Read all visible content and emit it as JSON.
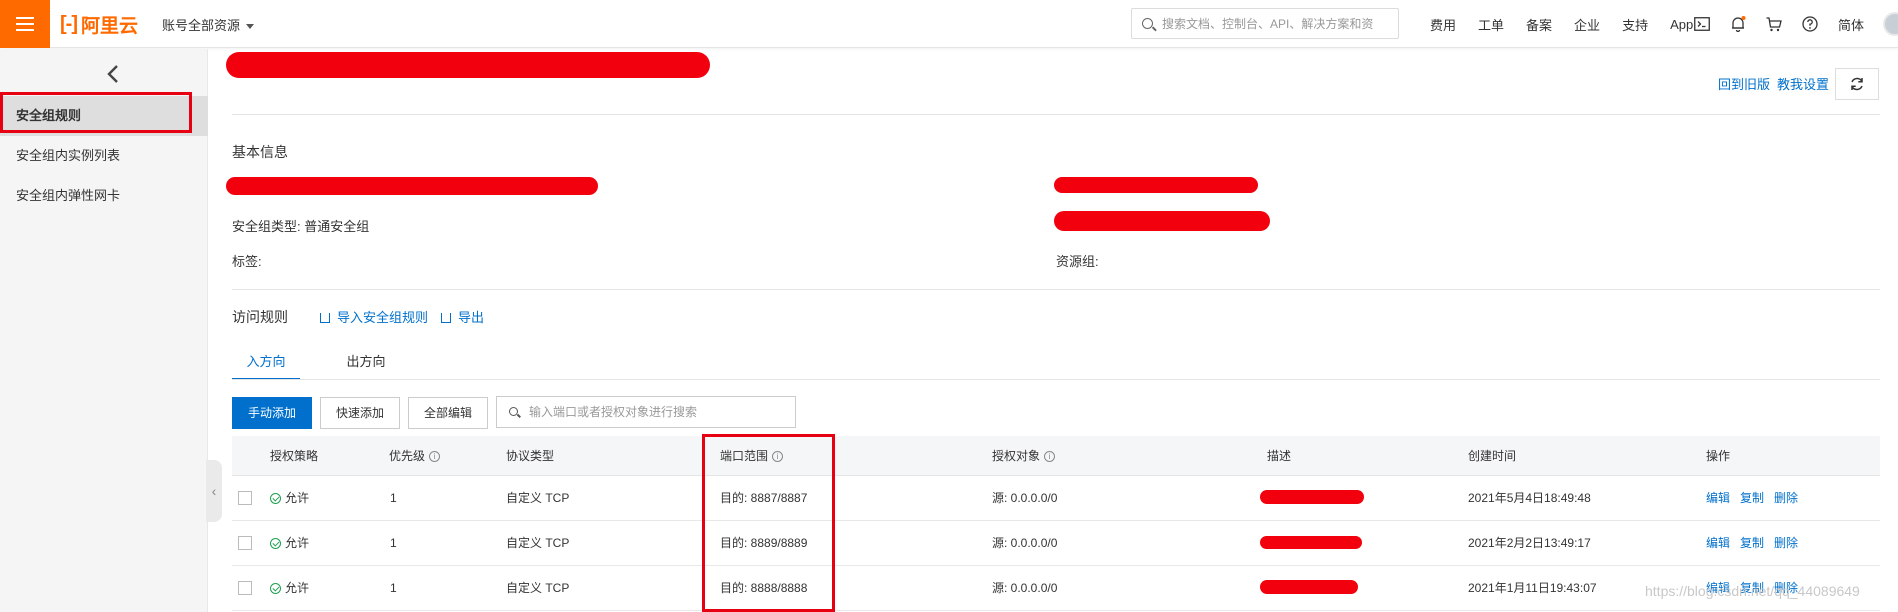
{
  "topbar": {
    "logo_text": "阿里云",
    "resource_selector": "账号全部资源",
    "search_placeholder": "搜索文档、控制台、API、解决方案和资",
    "links": [
      "费用",
      "工单",
      "备案",
      "企业",
      "支持",
      "App"
    ],
    "language": "简体",
    "icons": [
      "terminal-icon",
      "bell-icon",
      "cart-icon",
      "help-icon"
    ]
  },
  "sidebar": {
    "items": [
      {
        "label": "安全组规则",
        "active": true
      },
      {
        "label": "安全组内实例列表",
        "active": false
      },
      {
        "label": "安全组内弹性网卡",
        "active": false
      }
    ]
  },
  "header": {
    "back_to_old": "回到旧版",
    "teach_me": "教我设置"
  },
  "basic_info": {
    "title": "基本信息",
    "type_label": "安全组类型:",
    "type_value": "普通安全组",
    "tags_label": "标签:",
    "resource_group_label": "资源组:"
  },
  "rules": {
    "title": "访问规则",
    "import_label": "导入安全组规则",
    "export_label": "导出",
    "tabs": [
      "入方向",
      "出方向"
    ],
    "buttons": {
      "manual_add": "手动添加",
      "quick_add": "快速添加",
      "edit_all": "全部编辑"
    },
    "filter_placeholder": "输入端口或者授权对象进行搜索",
    "columns": [
      "授权策略",
      "优先级",
      "协议类型",
      "端口范围",
      "授权对象",
      "描述",
      "创建时间",
      "操作"
    ],
    "rows": [
      {
        "policy": "允许",
        "priority": "1",
        "protocol": "自定义 TCP",
        "port": "目的: 8887/8887",
        "source": "源: 0.0.0.0/0",
        "created": "2021年5月4日18:49:48"
      },
      {
        "policy": "允许",
        "priority": "1",
        "protocol": "自定义 TCP",
        "port": "目的: 8889/8889",
        "source": "源: 0.0.0.0/0",
        "created": "2021年2月2日13:49:17"
      },
      {
        "policy": "允许",
        "priority": "1",
        "protocol": "自定义 TCP",
        "port": "目的: 8888/8888",
        "source": "源: 0.0.0.0/0",
        "created": "2021年1月11日19:43:07"
      }
    ],
    "ops": [
      "编辑",
      "复制",
      "删除"
    ]
  },
  "watermark": "https://blog.csdn.net/qq_44089649",
  "colors": {
    "accent": "#ff6a00",
    "link": "#0070cc",
    "highlight_box": "#e60012",
    "allow": "#1ea04f"
  }
}
